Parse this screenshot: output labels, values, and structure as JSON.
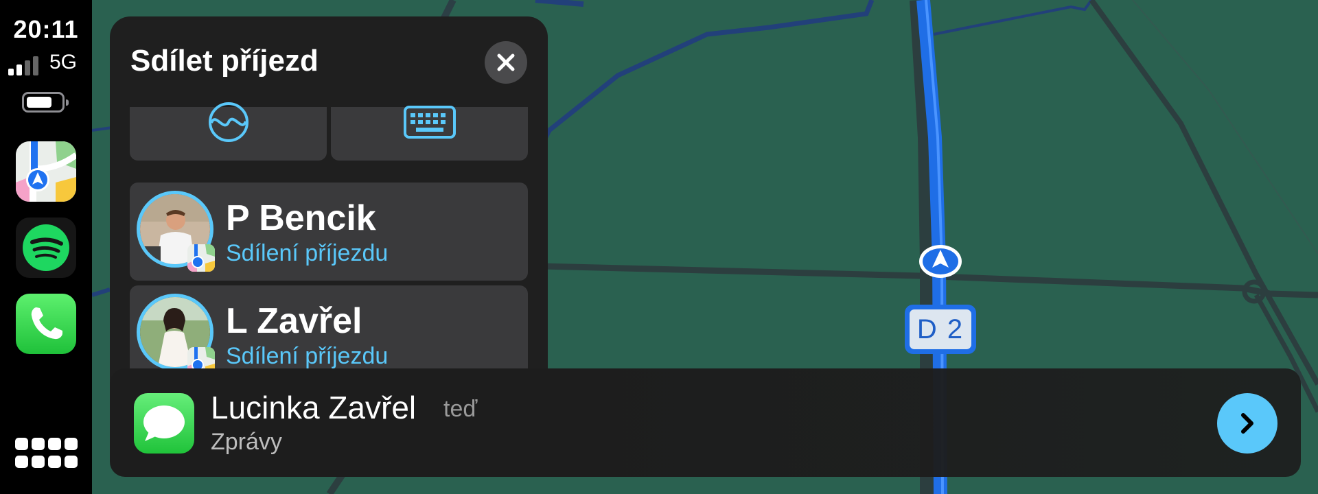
{
  "status": {
    "time": "20:11",
    "network": "5G",
    "signal_bars_active": 2,
    "signal_bars_total": 4
  },
  "dock": {
    "apps": [
      {
        "name": "Maps",
        "icon": "maps-icon"
      },
      {
        "name": "Spotify",
        "icon": "spotify-icon"
      },
      {
        "name": "Phone",
        "icon": "phone-icon"
      }
    ],
    "home_icon": "app-grid-icon"
  },
  "share_panel": {
    "title": "Sdílet příjezd",
    "close_icon": "close-icon",
    "options": [
      {
        "icon": "siri-icon"
      },
      {
        "icon": "keyboard-icon"
      }
    ],
    "contacts": [
      {
        "name": "P Bencik",
        "subtitle": "Sdílení příjezdu"
      },
      {
        "name": "L Zavřel",
        "subtitle": "Sdílení příjezdu"
      }
    ]
  },
  "notification": {
    "sender": "Lucinka Zavřel",
    "time": "teď",
    "app": "Zprávy",
    "icon": "messages-icon",
    "action_icon": "chevron-right-icon"
  },
  "map": {
    "road_label": "D 2",
    "route_color": "#1f6ee6",
    "land_color": "#2a6150",
    "road_color": "#2c3e3f"
  }
}
